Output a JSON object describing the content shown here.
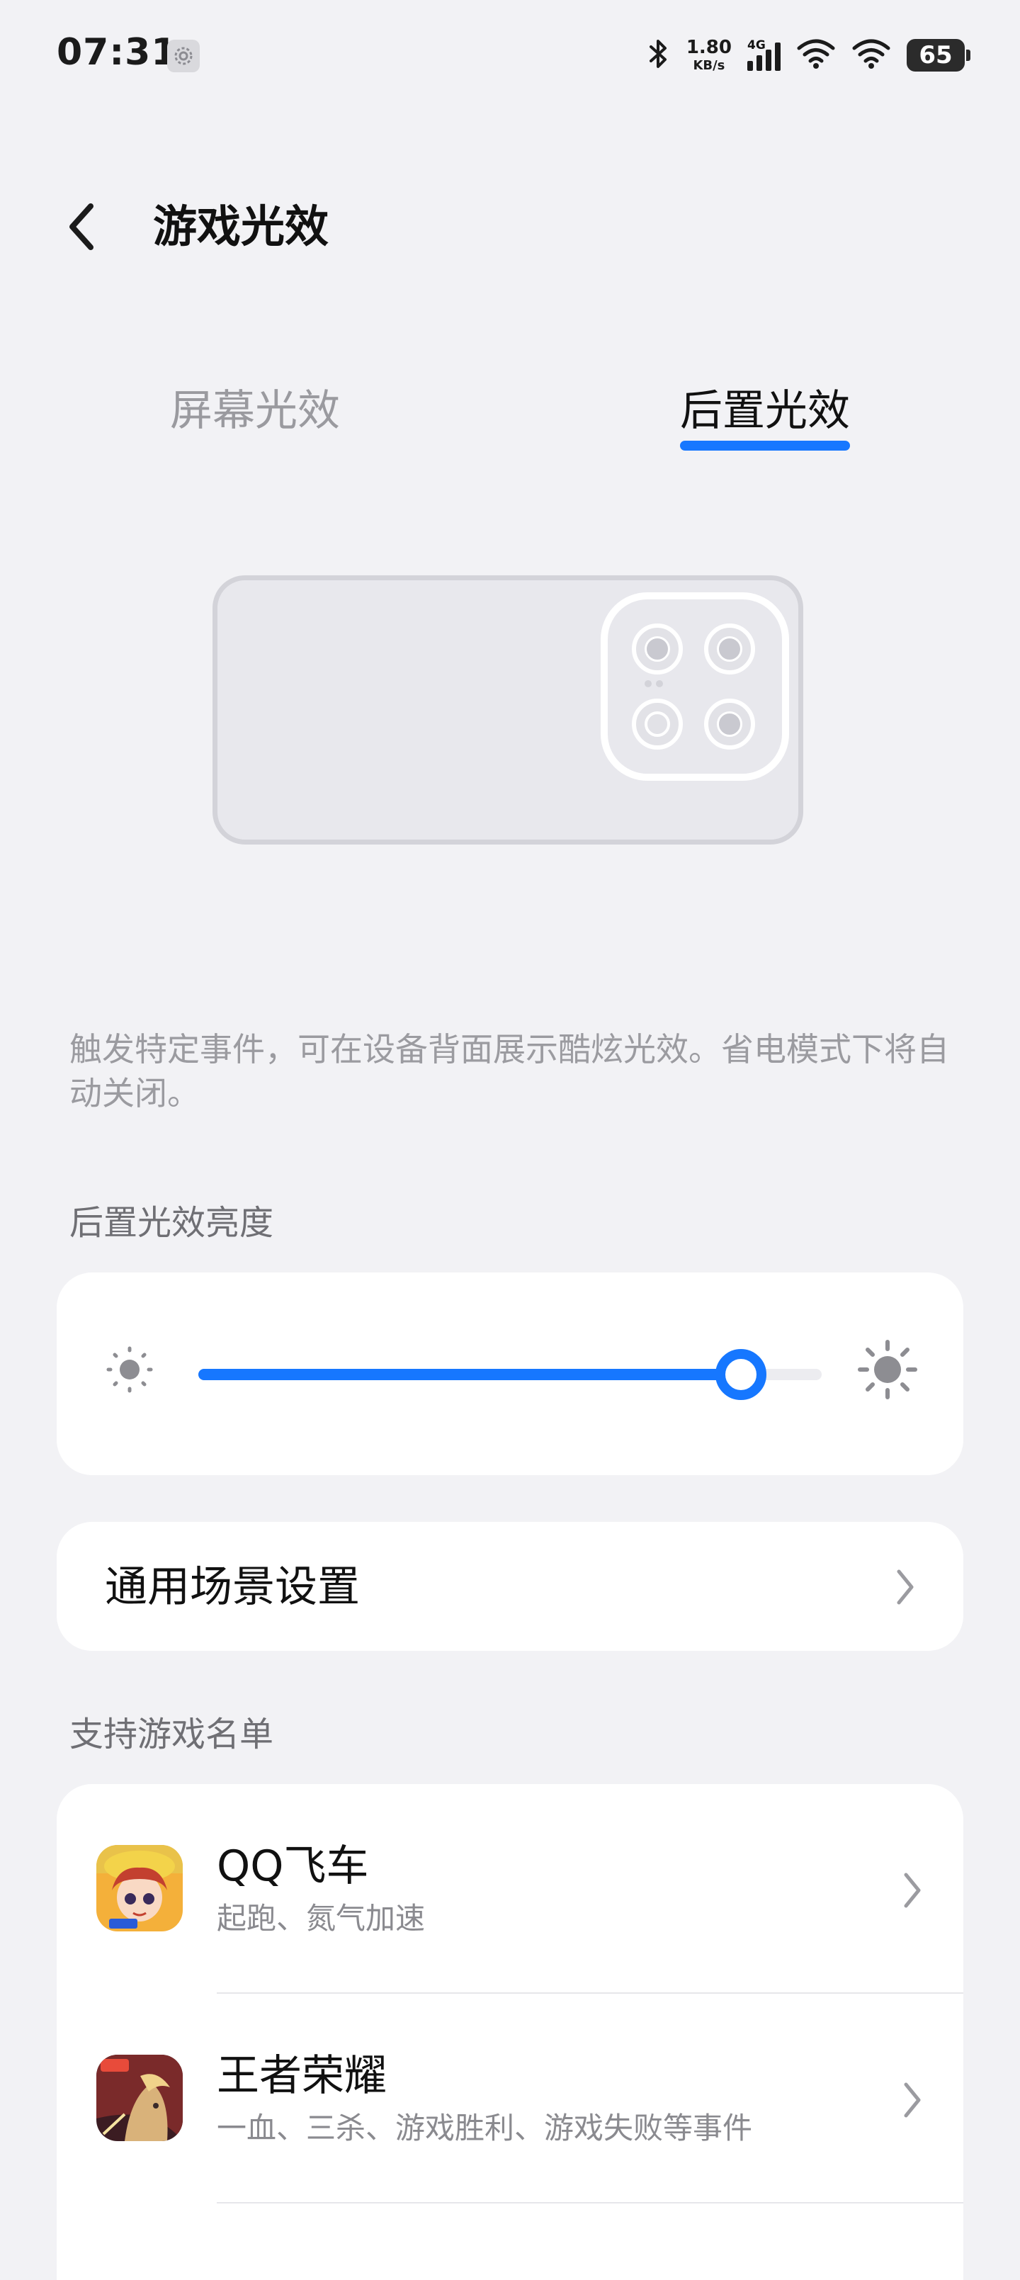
{
  "status_bar": {
    "time": "07:31",
    "net_speed_value": "1.80",
    "net_speed_unit": "KB/s",
    "network_type": "4G",
    "battery_level": "65",
    "icons": [
      "settings-icon",
      "bluetooth-icon",
      "signal-icon",
      "wifi-icon",
      "wifi-icon",
      "battery-icon"
    ]
  },
  "header": {
    "title": "游戏光效",
    "back_icon": "chevron-left-icon"
  },
  "tabs": [
    {
      "label": "屏幕光效",
      "selected": false
    },
    {
      "label": "后置光效",
      "selected": true
    }
  ],
  "colors": {
    "accent": "#1677ff",
    "background": "#f2f2f5",
    "card": "#ffffff",
    "secondary_text": "#9b9ba0"
  },
  "description": "触发特定事件，可在设备背面展示酷炫光效。省电模式下将自动关闭。",
  "brightness": {
    "section_label": "后置光效亮度",
    "value_fraction": 0.87,
    "min_icon": "brightness-low-icon",
    "max_icon": "brightness-high-icon"
  },
  "scene_settings": {
    "label": "通用场景设置",
    "icon": "chevron-right-icon"
  },
  "games": {
    "section_label": "支持游戏名单",
    "items": [
      {
        "name": "QQ飞车",
        "events": "起跑、氮气加速",
        "icon": "qq-speed-app-icon"
      },
      {
        "name": "王者荣耀",
        "events": "一血、三杀、游戏胜利、游戏失败等事件",
        "icon": "honor-of-kings-app-icon"
      }
    ]
  }
}
